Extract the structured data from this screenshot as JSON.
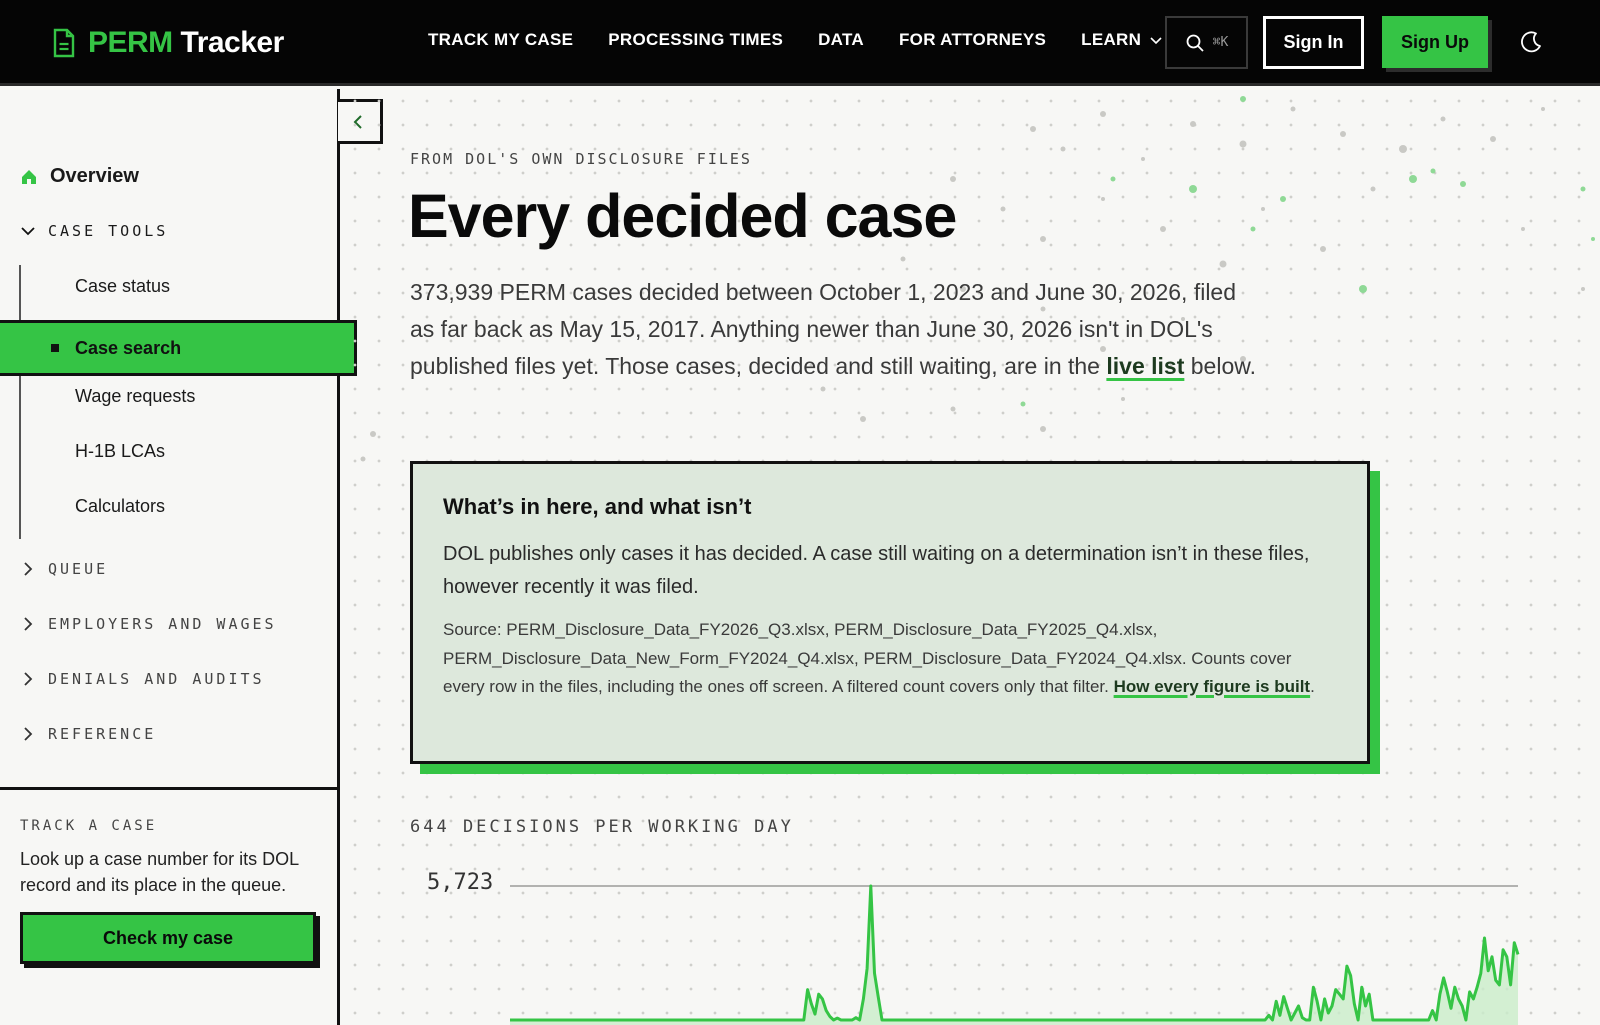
{
  "brand": {
    "name_accent": "PERM",
    "name_rest": " Tracker",
    "accent_color": "#35c445"
  },
  "nav": {
    "links": [
      "TRACK MY CASE",
      "PROCESSING TIMES",
      "DATA",
      "FOR ATTORNEYS",
      "LEARN"
    ],
    "search_shortcut": "⌘K",
    "signin_label": "Sign In",
    "signup_label": "Sign Up"
  },
  "sidebar": {
    "overview": "Overview",
    "case_tools": {
      "heading": "CASE TOOLS",
      "items": [
        "Case status",
        "Case search",
        "Wage requests",
        "H-1B LCAs",
        "Calculators"
      ],
      "active": "Case search"
    },
    "groups": [
      "QUEUE",
      "EMPLOYERS AND WAGES",
      "DENIALS AND AUDITS",
      "REFERENCE"
    ],
    "track": {
      "heading": "TRACK A CASE",
      "text": "Look up a case number for its DOL record and its place in the queue.",
      "button": "Check my case"
    }
  },
  "main": {
    "kicker": "FROM DOL'S OWN DISCLOSURE FILES",
    "title": "Every decided case",
    "lead_text": "373,939 PERM cases decided between October 1, 2023 and June 30, 2026, filed as far back as May 15, 2017. Anything newer than June 30, 2026 isn't in DOL's published files yet. Those cases, decided and still waiting, are in the ",
    "lead_link": "live list",
    "lead_tail": " below.",
    "callout": {
      "title": "What’s in here, and what isn’t",
      "body": "DOL publishes only cases it has decided. A case still waiting on a determination isn’t in these files, however recently it was filed.",
      "source": "Source: PERM_Disclosure_Data_FY2026_Q3.xlsx, PERM_Disclosure_Data_FY2025_Q4.xlsx, PERM_Disclosure_Data_New_Form_FY2024_Q4.xlsx, PERM_Disclosure_Data_FY2024_Q4.xlsx. Counts cover every row in the files, including the ones off screen. A filtered count covers only that filter. ",
      "link": "How every figure is built",
      "tail": "."
    },
    "chart": {
      "heading": "644 DECISIONS PER WORKING DAY",
      "max_label": "5,723"
    }
  },
  "chart_data": {
    "type": "area",
    "title": "644 DECISIONS PER WORKING DAY",
    "ymax_label": "5,723",
    "ylim": [
      0,
      5723
    ],
    "values": [
      0,
      0,
      0,
      0,
      0,
      0,
      0,
      0,
      0,
      0,
      0,
      0,
      0,
      0,
      0,
      0,
      0,
      0,
      0,
      0,
      0,
      0,
      0,
      0,
      0,
      0,
      0,
      0,
      0,
      0,
      0,
      0,
      0,
      0,
      0,
      0,
      0,
      0,
      0,
      0,
      0,
      0,
      0,
      0,
      0,
      0,
      0,
      0,
      0,
      0,
      0,
      0,
      0,
      0,
      0,
      0,
      0,
      0,
      0,
      0,
      0,
      0,
      0,
      0,
      0,
      0,
      0,
      0,
      0,
      0,
      0,
      0,
      0,
      0,
      0,
      0,
      0,
      0,
      0,
      0,
      1300,
      700,
      250,
      1100,
      900,
      400,
      150,
      0,
      80,
      0,
      0,
      0,
      0,
      100,
      0,
      900,
      2200,
      5723,
      2000,
      1000,
      0,
      0,
      0,
      0,
      0,
      0,
      0,
      0,
      0,
      0,
      0,
      0,
      0,
      0,
      0,
      0,
      0,
      0,
      0,
      0,
      0,
      0,
      0,
      0,
      0,
      0,
      0,
      0,
      0,
      0,
      0,
      0,
      0,
      0,
      0,
      0,
      0,
      0,
      0,
      0,
      0,
      0,
      0,
      0,
      0,
      0,
      0,
      0,
      0,
      0,
      0,
      0,
      0,
      0,
      0,
      0,
      0,
      0,
      0,
      0,
      0,
      0,
      0,
      0,
      0,
      0,
      0,
      0,
      0,
      0,
      0,
      0,
      0,
      0,
      0,
      0,
      0,
      0,
      0,
      0,
      0,
      0,
      0,
      0,
      0,
      0,
      0,
      0,
      0,
      0,
      0,
      0,
      0,
      0,
      0,
      0,
      0,
      0,
      0,
      0,
      0,
      0,
      0,
      0,
      200,
      0,
      800,
      200,
      1000,
      500,
      0,
      300,
      600,
      100,
      0,
      0,
      1400,
      800,
      0,
      900,
      300,
      600,
      1300,
      1100,
      900,
      2300,
      1900,
      700,
      0,
      1400,
      600,
      1100,
      0,
      0,
      0,
      0,
      0,
      0,
      0,
      0,
      0,
      0,
      0,
      0,
      0,
      0,
      0,
      0,
      400,
      0,
      1100,
      1800,
      1200,
      500,
      1400,
      900,
      600,
      0,
      1200,
      900,
      1400,
      2000,
      3500,
      2100,
      2700,
      1700,
      1500,
      3000,
      2700,
      1500,
      3300,
      2800
    ]
  }
}
